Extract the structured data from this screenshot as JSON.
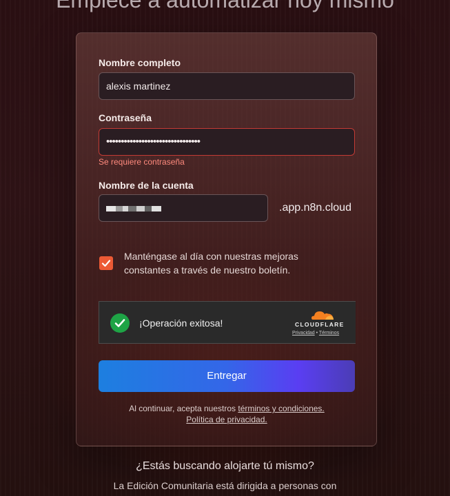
{
  "header": {
    "title": "Empiece a automatizar hoy mismo"
  },
  "form": {
    "full_name_label": "Nombre completo",
    "full_name_value": "alexis martinez",
    "password_label": "Contraseña",
    "password_value": "••••••••••••••••••••••••••••••••",
    "password_error": "Se requiere contraseña",
    "account_label": "Nombre de la cuenta",
    "account_domain_suffix": ".app.n8n.cloud",
    "newsletter_checked": true,
    "newsletter_text": "Manténgase al día con nuestras mejoras constantes a través de nuestro boletín."
  },
  "captcha": {
    "status_text": "¡Operación exitosa!",
    "brand": "CLOUDFLARE",
    "privacy_link": "Privacidad",
    "separator": "•",
    "terms_link": "Términos"
  },
  "submit": {
    "label": "Entregar"
  },
  "legal": {
    "prefix": "Al continuar, acepta nuestros",
    "terms_link": "términos y condiciones.",
    "privacy_link": "Política de privacidad."
  },
  "selfhost": {
    "title": "¿Estás buscando alojarte tú mismo?",
    "body": "La Edición Comunitaria está dirigida a personas con"
  },
  "colors": {
    "accent": "#ec5a35",
    "error": "#c43b35",
    "success": "#1ea446",
    "button_start": "#1d7fe0",
    "button_end": "#5a3ef2"
  },
  "icons": [
    "check-icon",
    "cloudflare-cloud-icon"
  ]
}
